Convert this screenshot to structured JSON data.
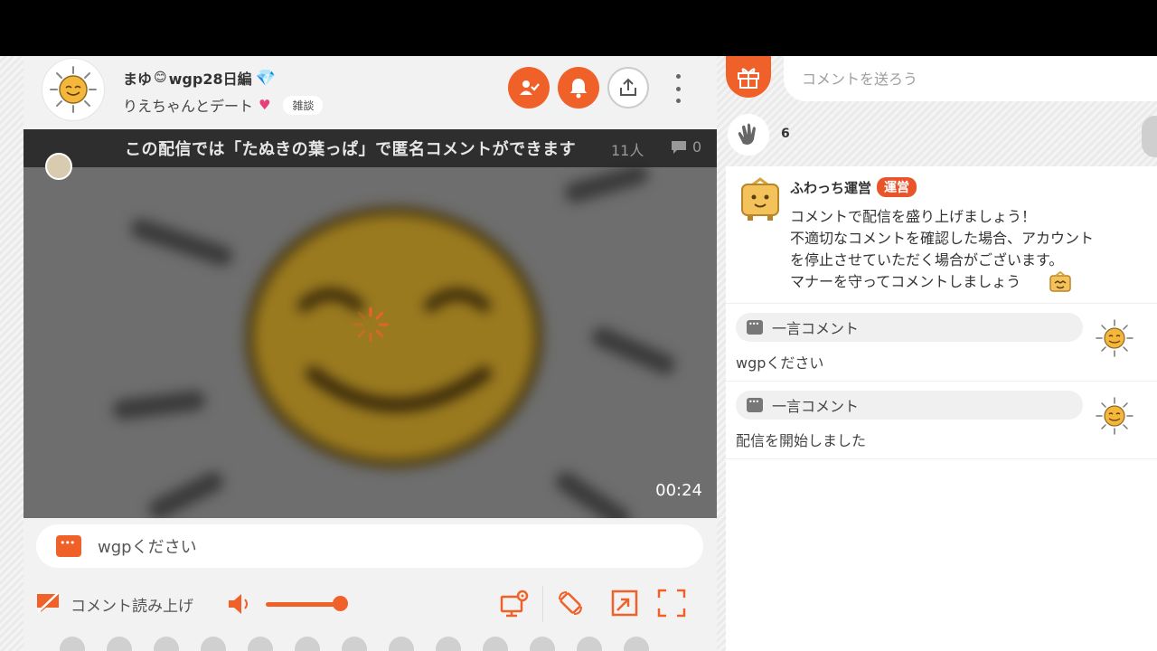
{
  "streamer": {
    "name": "まゆ",
    "name_suffix": "wgp28日編",
    "subtitle": "りえちゃんとデート",
    "category_tag": "雑談"
  },
  "header_buttons": {
    "follow_icon": "user-check-icon",
    "notify_icon": "bell-icon",
    "share_icon": "share-icon",
    "more_icon": "more-vertical-icon"
  },
  "video": {
    "banner": "この配信では「たぬきの葉っぱ」で匿名コメントができます",
    "viewers": "11人",
    "comment_count": "0",
    "elapsed": "00:24"
  },
  "quick_comment": {
    "value": "wgpください"
  },
  "controls": {
    "read_aloud_label": "コメント読み上げ",
    "volume_level": 0.85
  },
  "right": {
    "comment_placeholder": "コメントを送ろう",
    "clap_count": "6"
  },
  "official_message": {
    "name": "ふわっち運営",
    "badge": "運営",
    "text": "コメントで配信を盛り上げましょう！\n不適切なコメントを確認した場合、アカウント\nを停止させていただく場合がございます。\nマナーを守ってコメントしましょう"
  },
  "comments": [
    {
      "header": "一言コメント",
      "body": "wgpください"
    },
    {
      "header": "一言コメント",
      "body": "配信を開始しました"
    }
  ],
  "colors": {
    "accent": "#f0612a",
    "badge": "#e9542a"
  }
}
